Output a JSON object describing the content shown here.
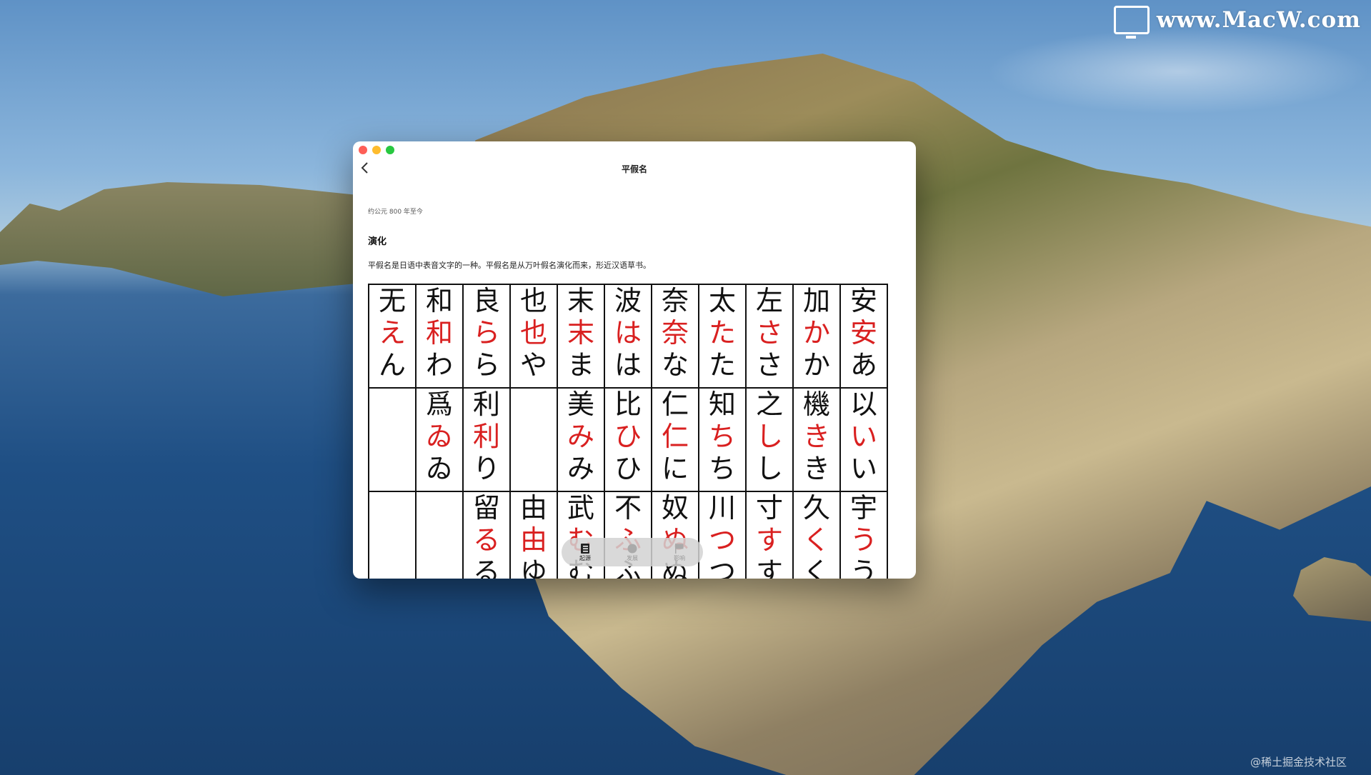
{
  "watermark": {
    "site": "www.MacW.com",
    "credit": "@稀土掘金技术社区"
  },
  "window": {
    "title": "平假名",
    "date": "约公元 800 年至今",
    "section_heading": "演化",
    "description": "平假名是日语中表音文字的一种。平假名是从万叶假名演化而来，形近汉语草书。"
  },
  "table": {
    "rows": [
      [
        {
          "k": "无",
          "a": "え",
          "b": "ん"
        },
        {
          "k": "和",
          "a": "和",
          "b": "わ"
        },
        {
          "k": "良",
          "a": "ら",
          "b": "ら"
        },
        {
          "k": "也",
          "a": "也",
          "b": "や"
        },
        {
          "k": "末",
          "a": "末",
          "b": "ま"
        },
        {
          "k": "波",
          "a": "は",
          "b": "は"
        },
        {
          "k": "奈",
          "a": "奈",
          "b": "な"
        },
        {
          "k": "太",
          "a": "た",
          "b": "た"
        },
        {
          "k": "左",
          "a": "さ",
          "b": "さ"
        },
        {
          "k": "加",
          "a": "か",
          "b": "か"
        },
        {
          "k": "安",
          "a": "安",
          "b": "あ"
        }
      ],
      [
        {
          "k": "",
          "a": "",
          "b": ""
        },
        {
          "k": "爲",
          "a": "ゐ",
          "b": "ゐ"
        },
        {
          "k": "利",
          "a": "利",
          "b": "り"
        },
        {
          "k": "",
          "a": "",
          "b": ""
        },
        {
          "k": "美",
          "a": "み",
          "b": "み"
        },
        {
          "k": "比",
          "a": "ひ",
          "b": "ひ"
        },
        {
          "k": "仁",
          "a": "仁",
          "b": "に"
        },
        {
          "k": "知",
          "a": "ち",
          "b": "ち"
        },
        {
          "k": "之",
          "a": "し",
          "b": "し"
        },
        {
          "k": "機",
          "a": "き",
          "b": "き"
        },
        {
          "k": "以",
          "a": "い",
          "b": "い"
        }
      ],
      [
        {
          "k": "",
          "a": "",
          "b": ""
        },
        {
          "k": "",
          "a": "",
          "b": ""
        },
        {
          "k": "留",
          "a": "る",
          "b": "る"
        },
        {
          "k": "由",
          "a": "由",
          "b": "ゆ"
        },
        {
          "k": "武",
          "a": "む",
          "b": "む"
        },
        {
          "k": "不",
          "a": "ふ",
          "b": "ふ"
        },
        {
          "k": "奴",
          "a": "ぬ",
          "b": "ぬ"
        },
        {
          "k": "川",
          "a": "つ",
          "b": "つ"
        },
        {
          "k": "寸",
          "a": "す",
          "b": "す"
        },
        {
          "k": "久",
          "a": "く",
          "b": "く"
        },
        {
          "k": "宇",
          "a": "う",
          "b": "う"
        }
      ]
    ]
  },
  "bottom_tabs": [
    {
      "label": "起源",
      "icon": "list-icon",
      "active": true
    },
    {
      "label": "发展",
      "icon": "circle-icon",
      "active": false
    },
    {
      "label": "影响",
      "icon": "flag-icon",
      "active": false
    }
  ],
  "colors": {
    "accent_red": "#d92020"
  }
}
